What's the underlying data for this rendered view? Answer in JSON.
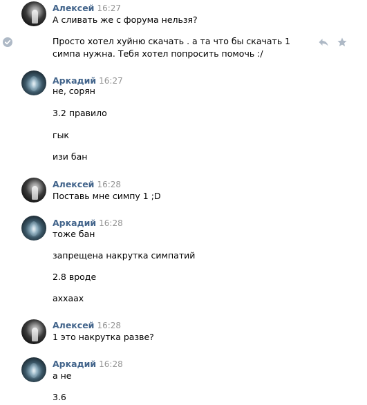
{
  "messages": [
    {
      "author": "Алексей",
      "time": "16:27",
      "lines": [
        "А сливать же с форума нельзя?",
        "Просто хотел хуйню скачать . а та что бы скачать 1 симпа нужна. Тебя хотел попросить помочь :/"
      ]
    },
    {
      "author": "Аркадий",
      "time": "16:27",
      "lines": [
        "не, сорян",
        "3.2 правило",
        "гык",
        "изи бан"
      ]
    },
    {
      "author": "Алексей",
      "time": "16:28",
      "lines": [
        "Поставь мне симпу 1 ;D"
      ]
    },
    {
      "author": "Аркадий",
      "time": "16:28",
      "lines": [
        "тоже бан",
        "запрещена накрутка симпатий",
        "2.8 вроде",
        "аххаах"
      ]
    },
    {
      "author": "Алексей",
      "time": "16:28",
      "lines": [
        "1 это накрутка разве?"
      ]
    },
    {
      "author": "Аркадий",
      "time": "16:28",
      "lines": [
        "а не",
        "3.6"
      ]
    }
  ],
  "icons": {
    "selected": "check-circle-icon",
    "reply": "reply-arrow-icon",
    "favorite": "star-icon"
  },
  "colors": {
    "author": "#42648b",
    "time": "#939393",
    "text": "#000000",
    "icon": "#aeb9c6"
  }
}
